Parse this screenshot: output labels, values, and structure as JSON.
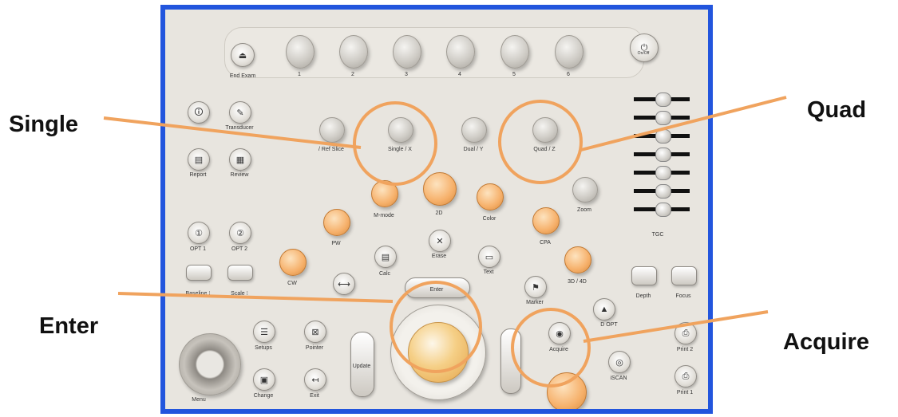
{
  "callouts": {
    "single": "Single",
    "quad": "Quad",
    "enter": "Enter",
    "acquire": "Acquire"
  },
  "panel": {
    "end_exam": "End Exam",
    "knobs": [
      "1",
      "2",
      "3",
      "4",
      "5",
      "6"
    ],
    "power": "On/Off",
    "transducer": "Transducer",
    "report": "Report",
    "review": "Review",
    "opt1": "OPT 1",
    "opt2": "OPT 2",
    "baseline": "Baseline ⁝",
    "scale": "Scale ⁝",
    "ref_slice": "/ Ref Slice",
    "single_x": "Single / X",
    "dual_y": "Dual / Y",
    "quad_z": "Quad / Z",
    "zoom": "Zoom",
    "tgc": "TGC",
    "mmode": "M-mode",
    "mode_2d": "2D",
    "color": "Color",
    "pw": "PW",
    "cpa": "CPA",
    "calc": "Calc",
    "erase": "Erase",
    "text": "Text",
    "cw": "CW",
    "mode_3d4d": "3D / 4D",
    "depth": "Depth",
    "focus": "Focus",
    "enter": "Enter",
    "marker": "Marker",
    "d_opt": "D OPT",
    "setups": "Setups",
    "pointer": "Pointer",
    "update": "Update",
    "acquire": "Acquire",
    "print2": "Print 2",
    "menu": "Menu",
    "change": "Change",
    "exit": "Exit",
    "iscan": "iSCAN",
    "print1": "Print 1"
  },
  "colors": {
    "callout_line": "#f0a35e",
    "frame": "#2255dd"
  }
}
